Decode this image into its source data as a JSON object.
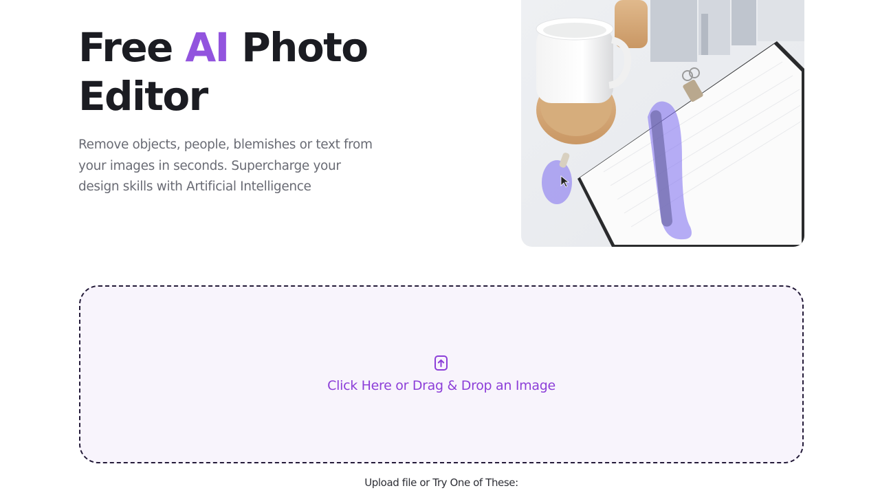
{
  "hero": {
    "title_part1": "Free ",
    "title_accent": "AI",
    "title_part2": " Photo Editor",
    "subtitle": "Remove objects, people, blemishes or text from your images in seconds. Supercharge your design skills with Artificial Intelligence"
  },
  "dropzone": {
    "label": "Click Here or Drag & Drop an Image",
    "icon": "file-upload-icon"
  },
  "upload_hint": "Upload file or Try One of These:",
  "colors": {
    "accent": "#9254de",
    "label": "#8c3ed8",
    "dropzone_bg": "#f8f4fc",
    "dropzone_border": "#231a38",
    "mask": "#7b6cf0"
  }
}
